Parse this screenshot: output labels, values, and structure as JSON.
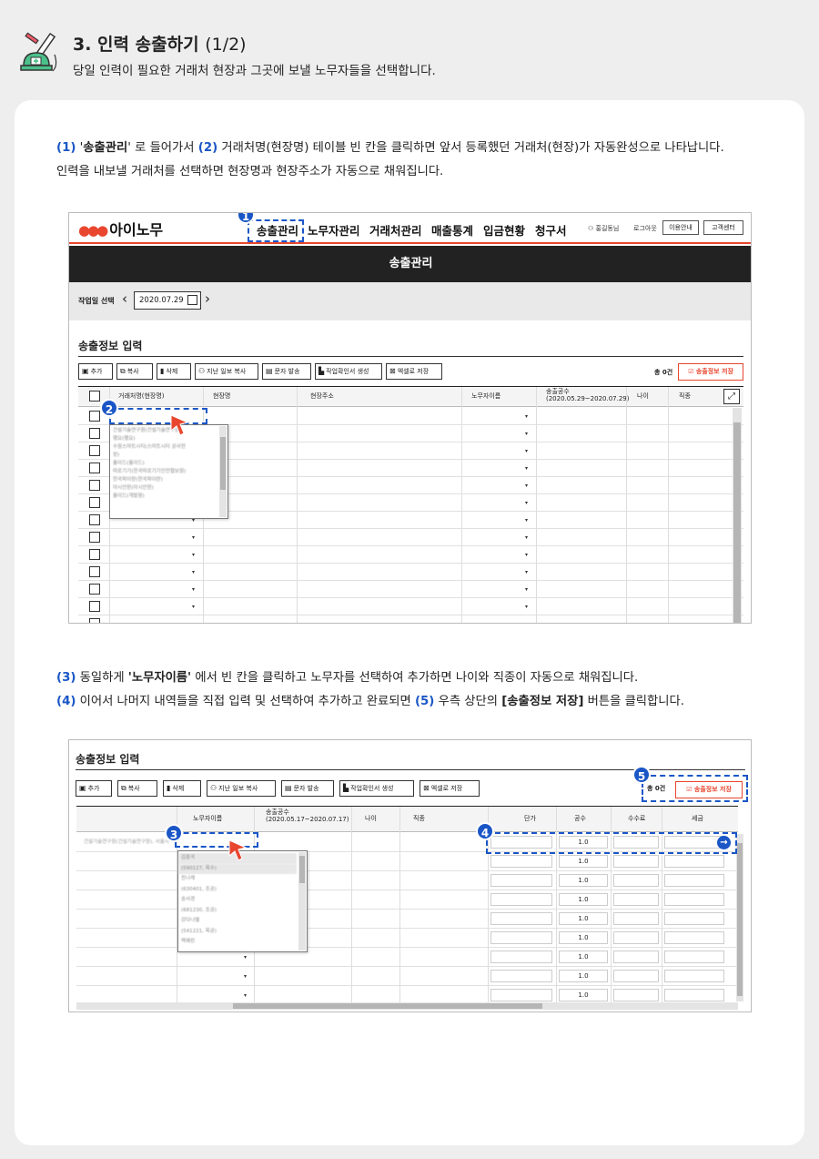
{
  "header": {
    "title": "3. 인력 송출하기",
    "page": "(1/2)",
    "subtitle": "당일 인력이 필요한 거래처 현장과 그곳에 보낼 노무자들을 선택합니다."
  },
  "para1": {
    "n1": "(1)",
    "q1": "'",
    "b1": "송출관리",
    "t1": "' 로 들어가서 ",
    "n2": "(2)",
    "t2": " 거래처명(현장명) 테이블 빈 칸을 클릭하면 앞서 등록했던 거래처(현장)가 자동완성으로 나타납니다.",
    "line2": "인력을 내보낼 거래처를 선택하면 현장명과 현장주소가 자동으로 채워집니다."
  },
  "para2": {
    "n3": "(3)",
    "t3a": " 동일하게 ",
    "b3": "'노무자이름'",
    "t3b": " 에서 빈 칸을 클릭하고 노무자를 선택하여 추가하면 나이와 직종이 자동으로 채워집니다.",
    "n4": "(4)",
    "t4": " 이어서 나머지 내역들을 직접 입력 및 선택하여 추가하고 완료되면 ",
    "n5": "(5)",
    "t5a": " 우측 상단의 ",
    "b5": "[송출정보 저장]",
    "t5b": " 버튼을 클릭합니다."
  },
  "app": {
    "logo": "아이노무",
    "menu": [
      "송출관리",
      "노무자관리",
      "거래처관리",
      "매출통계",
      "입금현황",
      "청구서"
    ],
    "user": "홍길동님",
    "logout": "로그아웃",
    "guide_btn": "이용안내",
    "support_btn": "고객센터",
    "banner": "송출관리",
    "date_label": "작업일 선택",
    "date_value": "2020.07.29",
    "section_title": "송출정보 입력",
    "toolbar": [
      "추가",
      "복사",
      "삭제",
      "지난 일보 복사",
      "문자 발송",
      "작업확인서 생성",
      "엑셀로 저장"
    ],
    "count": "총 0건",
    "save_btn": "송출정보 저장",
    "columns": [
      "거래처명(현장명)",
      "현장명",
      "현장주소",
      "노무자이름",
      "송출공수",
      "(2020.05.29~2020.07.29)",
      "나이",
      "직종"
    ],
    "dropdown_items": [
      "건설기술연구원(건설기술연구원)",
      "행요(행요)",
      "수원스마트시티(스마트시티 공사현",
      "장)",
      "올이드(올이드)",
      "따로기기(한국따로기기안전협보원)",
      "한국파이란(한국파이란)",
      "아시안윈(아시안윈)",
      "올이드(개발원)"
    ]
  },
  "app2": {
    "section_title": "송출정보 입력",
    "toolbar": [
      "추가",
      "복사",
      "삭제",
      "지난 일보 복사",
      "문자 발송",
      "작업확인서 생성",
      "엑셀로 저장"
    ],
    "count": "총 0건",
    "save_btn": "송출정보 저장",
    "columns": [
      "노무자이름",
      "송출공수",
      "(2020.05.17~2020.07.17)",
      "나이",
      "직종",
      "단가",
      "공수",
      "수수료",
      "세금"
    ],
    "first_row_client": "건설기술연구원(건설기술연구원), 서울시",
    "dropdown_items": [
      "김중국",
      "(590127, 목수)",
      "진나래",
      "(630401, 조공)",
      "송서경",
      "(681230, 조공)",
      "강다나엘",
      "(541221, 목공)",
      "백혜린"
    ],
    "gongsu_value": "1.0"
  },
  "badges": [
    "1",
    "2",
    "3",
    "4",
    "5"
  ]
}
